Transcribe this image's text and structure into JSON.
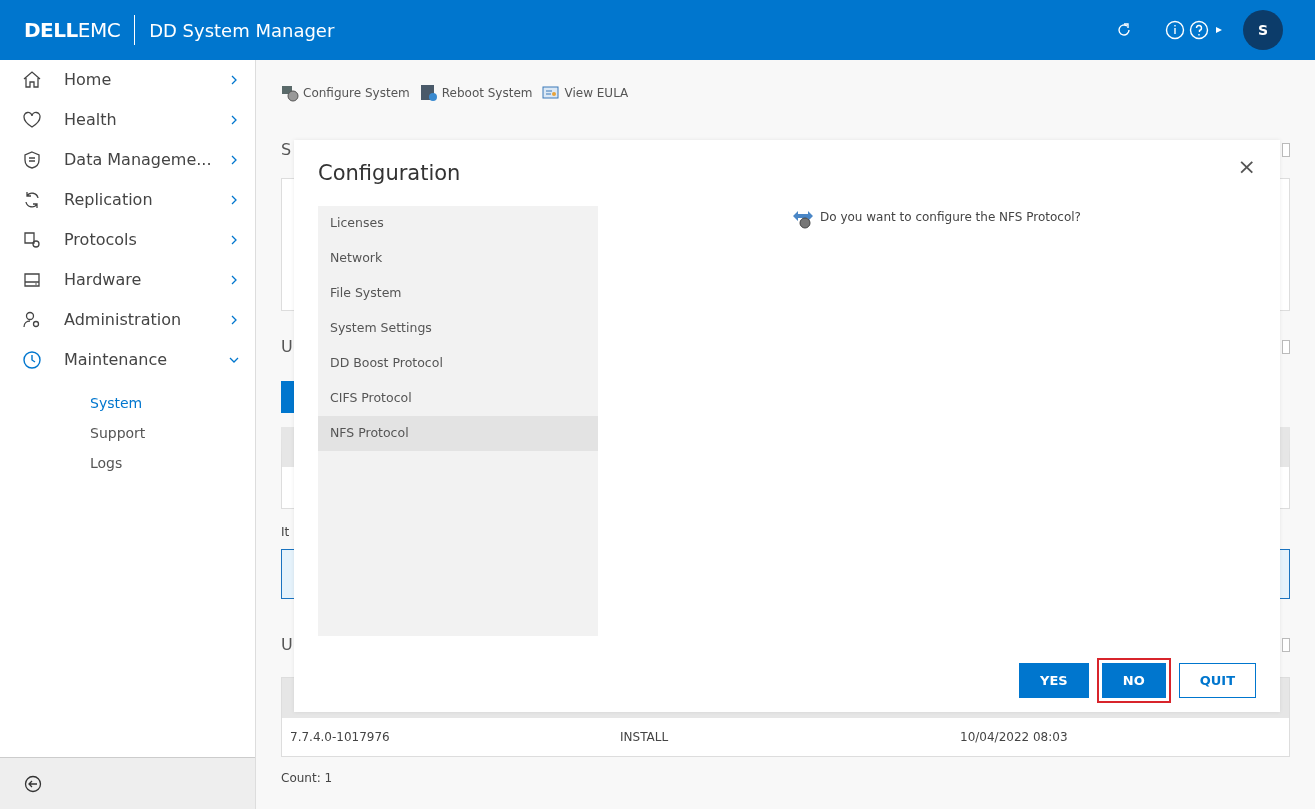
{
  "header": {
    "brand_bold": "DELL",
    "brand_light": "EMC",
    "title": "DD System Manager",
    "avatar": "S"
  },
  "sidebar": {
    "items": [
      {
        "label": "Home",
        "expanded": false
      },
      {
        "label": "Health",
        "expanded": false
      },
      {
        "label": "Data Manageme...",
        "expanded": false
      },
      {
        "label": "Replication",
        "expanded": false
      },
      {
        "label": "Protocols",
        "expanded": false
      },
      {
        "label": "Hardware",
        "expanded": false
      },
      {
        "label": "Administration",
        "expanded": false
      },
      {
        "label": "Maintenance",
        "expanded": true,
        "children": [
          {
            "label": "System",
            "selected": true
          },
          {
            "label": "Support",
            "selected": false
          },
          {
            "label": "Logs",
            "selected": false
          }
        ]
      }
    ]
  },
  "toolbar": [
    "Configure System",
    "Reboot System",
    "View EULA"
  ],
  "page": {
    "heading_1": "S",
    "checkbox_1": {
      "checked": false
    },
    "heading_2": "U",
    "checkbox_2": {
      "checked": false
    },
    "note": "It",
    "heading_3": "U",
    "checkbox_3": {
      "checked": false
    },
    "table_row": [
      "7.7.4.0-1017976",
      "INSTALL",
      "10/04/2022 08:03"
    ],
    "count": "Count: 1"
  },
  "dialog": {
    "title": "Configuration",
    "close": "×",
    "steps": [
      {
        "label": "Licenses",
        "selected": false
      },
      {
        "label": "Network",
        "selected": false
      },
      {
        "label": "File System",
        "selected": false
      },
      {
        "label": "System Settings",
        "selected": false
      },
      {
        "label": "DD Boost Protocol",
        "selected": false
      },
      {
        "label": "CIFS Protocol",
        "selected": false
      },
      {
        "label": "NFS Protocol",
        "selected": true
      }
    ],
    "question": "Do you want to configure the NFS Protocol?",
    "buttons": [
      {
        "label": "YES",
        "kind": "primary",
        "highlighted": false
      },
      {
        "label": "NO",
        "kind": "primary",
        "highlighted": true
      },
      {
        "label": "QUIT",
        "kind": "outline",
        "highlighted": false
      }
    ]
  }
}
